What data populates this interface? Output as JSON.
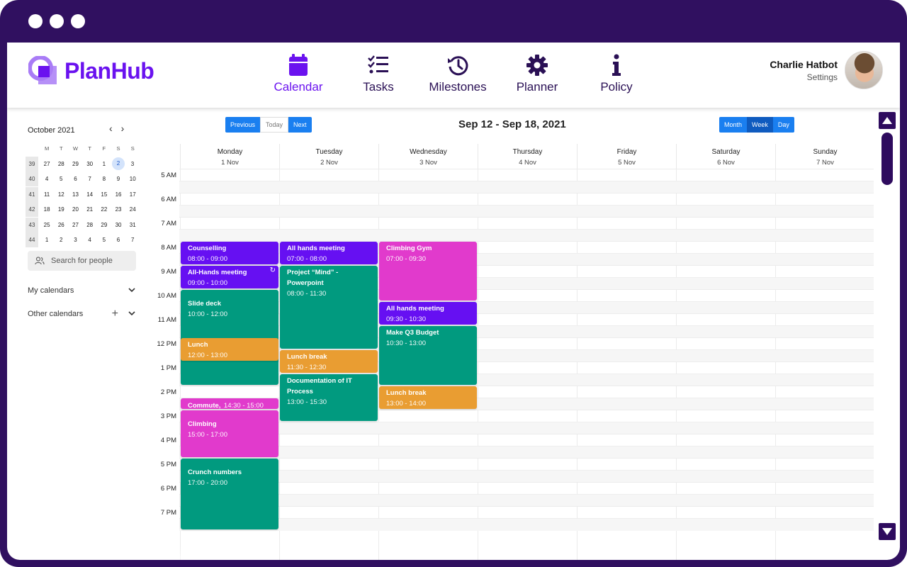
{
  "app": {
    "name": "PlanHub"
  },
  "nav": [
    {
      "label": "Calendar",
      "icon": "calendar-icon",
      "active": true
    },
    {
      "label": "Tasks",
      "icon": "tasks-icon",
      "active": false
    },
    {
      "label": "Milestones",
      "icon": "history-icon",
      "active": false
    },
    {
      "label": "Planner",
      "icon": "gear-icon",
      "active": false
    },
    {
      "label": "Policy",
      "icon": "info-icon",
      "active": false
    }
  ],
  "user": {
    "name": "Charlie Hatbot",
    "settings_label": "Settings"
  },
  "mini_calendar": {
    "title": "October 2021",
    "weekday_headers": [
      "M",
      "T",
      "W",
      "T",
      "F",
      "S",
      "S"
    ],
    "weeks": [
      {
        "week": "39",
        "days": [
          "27",
          "28",
          "29",
          "30",
          "1",
          "2",
          "3"
        ]
      },
      {
        "week": "40",
        "days": [
          "4",
          "5",
          "6",
          "7",
          "8",
          "9",
          "10"
        ]
      },
      {
        "week": "41",
        "days": [
          "11",
          "12",
          "13",
          "14",
          "15",
          "16",
          "17"
        ]
      },
      {
        "week": "42",
        "days": [
          "18",
          "19",
          "20",
          "21",
          "22",
          "23",
          "24"
        ]
      },
      {
        "week": "43",
        "days": [
          "25",
          "26",
          "27",
          "28",
          "29",
          "30",
          "31"
        ]
      },
      {
        "week": "44",
        "days": [
          "1",
          "2",
          "3",
          "4",
          "5",
          "6",
          "7"
        ]
      }
    ],
    "selected_day": "2"
  },
  "search": {
    "placeholder": "Search for people"
  },
  "sidebar": {
    "my_calendars": "My calendars",
    "other_calendars": "Other calendars"
  },
  "toolbar": {
    "previous": "Previous",
    "today": "Today",
    "next": "Next",
    "range": "Sep 12 - Sep 18, 2021",
    "month": "Month",
    "week": "Week",
    "day": "Day",
    "active_view": "Week"
  },
  "days": [
    {
      "name": "Monday",
      "date": "1 Nov"
    },
    {
      "name": "Tuesday",
      "date": "2 Nov"
    },
    {
      "name": "Wednesday",
      "date": "3 Nov"
    },
    {
      "name": "Thursday",
      "date": "4 Nov"
    },
    {
      "name": "Friday",
      "date": "5 Nov"
    },
    {
      "name": "Saturday",
      "date": "6 Nov"
    },
    {
      "name": "Sunday",
      "date": "7 Nov"
    }
  ],
  "hours": [
    "5 AM",
    "6 AM",
    "7 AM",
    "8 AM",
    "9 AM",
    "10 AM",
    "11 AM",
    "12 PM",
    "1 PM",
    "2 PM",
    "3 PM",
    "4 PM",
    "5 PM",
    "6 PM",
    "7 PM"
  ],
  "colors": {
    "brand": "#6a12ef",
    "purple": "#6610f2",
    "green": "#019a7f",
    "orange": "#e99d32",
    "magenta": "#e13acc",
    "frame": "#301060"
  },
  "events": [
    {
      "day": 0,
      "title": "Counselling",
      "time": "08:00 - 09:00",
      "start": 8,
      "end": 9,
      "color": "purple"
    },
    {
      "day": 0,
      "title": "All-Hands meeting",
      "time": "09:00 - 10:00",
      "start": 9,
      "end": 10,
      "color": "purple",
      "recurring": true
    },
    {
      "day": 0,
      "title": "Slide deck",
      "time": "10:00 - 12:00",
      "start": 10,
      "end": 14,
      "color": "green",
      "padtop": true
    },
    {
      "day": 0,
      "title": "Lunch",
      "time": "12:00 - 13:00",
      "start": 12,
      "end": 13,
      "color": "orange"
    },
    {
      "day": 0,
      "title": "Commute,",
      "time": "14:30 - 15:00",
      "start": 14.5,
      "end": 15,
      "color": "magenta",
      "inline": true
    },
    {
      "day": 0,
      "title": "Climbing",
      "time": "15:00 - 17:00",
      "start": 15,
      "end": 17,
      "color": "magenta",
      "padtop": true
    },
    {
      "day": 0,
      "title": "Crunch numbers",
      "time": "17:00 - 20:00",
      "start": 17,
      "end": 20,
      "color": "green",
      "padtop": true
    },
    {
      "day": 1,
      "title": "All hands meeting",
      "time": "07:00 - 08:00",
      "start": 8,
      "end": 9,
      "color": "purple"
    },
    {
      "day": 1,
      "title": "Project “Mind” - Powerpoint",
      "time": "08:00 - 11:30",
      "start": 9,
      "end": 12.5,
      "color": "green"
    },
    {
      "day": 1,
      "title": "Lunch break",
      "time": "11:30 - 12:30",
      "start": 12.5,
      "end": 13.5,
      "color": "orange"
    },
    {
      "day": 1,
      "title": "Documentation of IT Process",
      "time": "13:00 - 15:30",
      "start": 13.5,
      "end": 15.5,
      "color": "green"
    },
    {
      "day": 2,
      "title": "Climbing Gym",
      "time": "07:00 - 09:30",
      "start": 8,
      "end": 10.5,
      "color": "magenta"
    },
    {
      "day": 2,
      "title": "All hands meeting",
      "time": "09:30 - 10:30",
      "start": 10.5,
      "end": 11.5,
      "color": "purple"
    },
    {
      "day": 2,
      "title": "Make Q3 Budget",
      "time": "10:30 - 13:00",
      "start": 11.5,
      "end": 14,
      "color": "green"
    },
    {
      "day": 2,
      "title": "Lunch break",
      "time": "13:00 - 14:00",
      "start": 14,
      "end": 15,
      "color": "orange"
    }
  ]
}
